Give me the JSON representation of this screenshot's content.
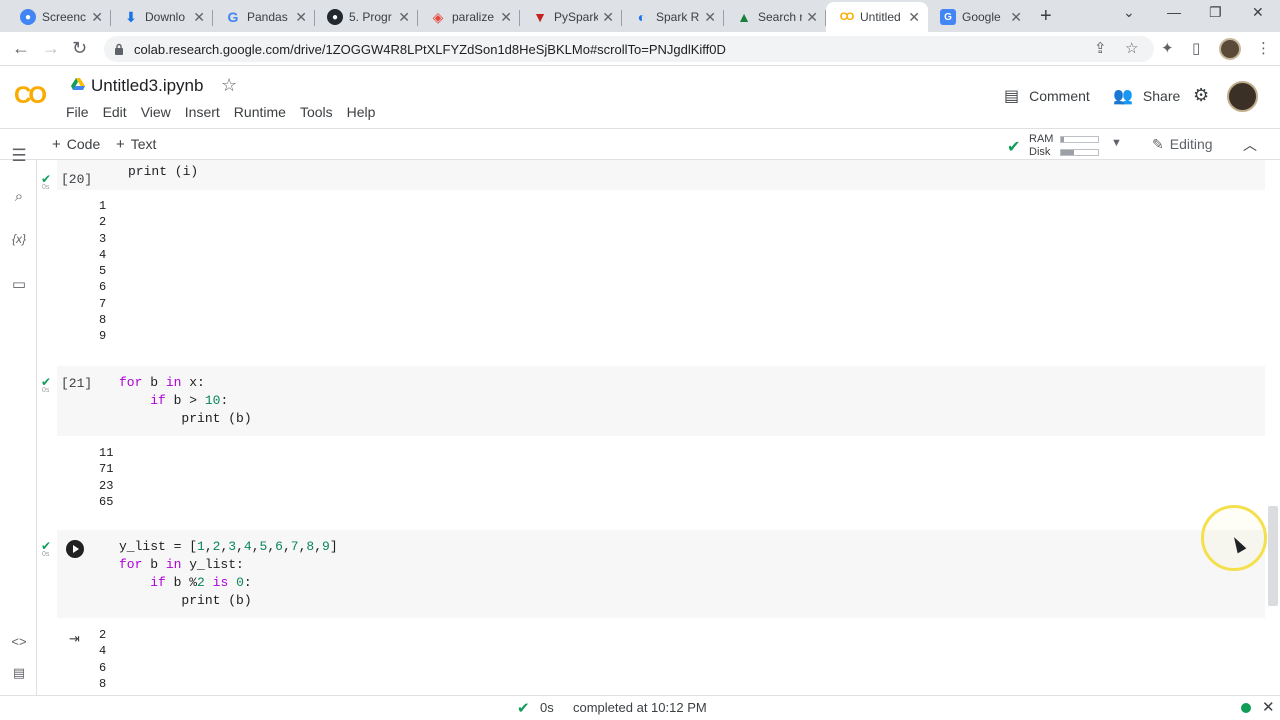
{
  "browser": {
    "tabs": [
      {
        "title": "Screenc",
        "icon": "screencast-icon",
        "color": "#4285f4"
      },
      {
        "title": "Downlo",
        "icon": "download-icon",
        "color": "#1a73e8"
      },
      {
        "title": "Pandas",
        "icon": "google-icon",
        "color": "#ea4335"
      },
      {
        "title": "5. Progr",
        "icon": "github-icon",
        "color": "#24292f"
      },
      {
        "title": "paralize",
        "icon": "databricks-icon",
        "color": "#e8453c"
      },
      {
        "title": "PySpark",
        "icon": "pyspark-icon",
        "color": "#c5221f"
      },
      {
        "title": "Spark R",
        "icon": "spark-icon",
        "color": "#1a73e8"
      },
      {
        "title": "Search r",
        "icon": "drive-icon",
        "color": "#188038"
      },
      {
        "title": "Untitled",
        "icon": "colab-icon",
        "color": "#f9ab00",
        "active": true
      },
      {
        "title": "Google",
        "icon": "google-docs-icon",
        "color": "#4285f4"
      }
    ],
    "url": "colab.research.google.com/drive/1ZOGGW4R8LPtXLFYZdSon1d8HeSjBKLMo#scrollTo=PNJgdlKiff0D"
  },
  "colab": {
    "logo": "CO",
    "title": "Untitled3.ipynb",
    "menu": [
      "File",
      "Edit",
      "View",
      "Insert",
      "Runtime",
      "Tools",
      "Help"
    ],
    "comment": "Comment",
    "share": "Share"
  },
  "toolbar": {
    "code": "Code",
    "text": "Text",
    "ram": "RAM",
    "disk": "Disk",
    "ram_usage": 0.08,
    "disk_usage": 0.35,
    "editing": "Editing"
  },
  "cells": {
    "c20": {
      "exec": "[20]",
      "time": "0s",
      "code": "print (i)",
      "output": "1\n2\n3\n4\n5\n6\n7\n8\n9"
    },
    "c21": {
      "exec": "[21]",
      "time": "0s",
      "output": "11\n71\n23\n65"
    },
    "c22": {
      "time": "0s",
      "output": "2\n4\n6\n8"
    }
  },
  "status": {
    "secs": "0s",
    "message": "completed at 10:12 PM"
  }
}
